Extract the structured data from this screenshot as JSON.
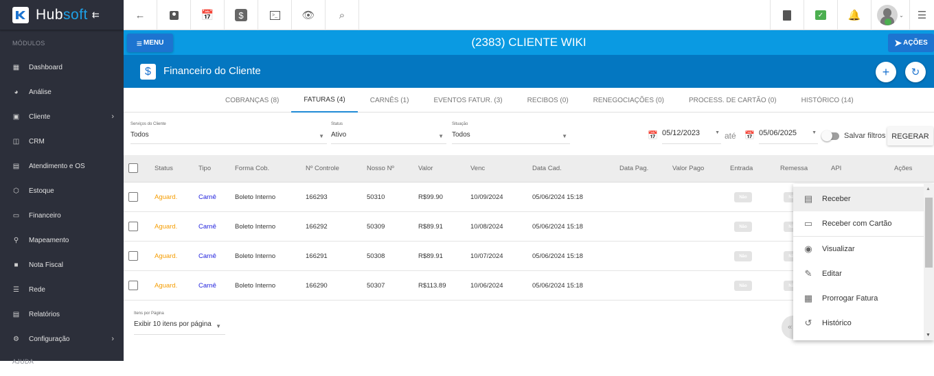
{
  "sidebar": {
    "brand_prefix": "Hub",
    "brand_suffix": "soft",
    "section_modules": "MÓDULOS",
    "section_help": "AJUDA",
    "items": [
      {
        "label": "Dashboard",
        "icon": "dashboard-icon",
        "has_chevron": false
      },
      {
        "label": "Análise",
        "icon": "pie-chart-icon",
        "has_chevron": false
      },
      {
        "label": "Cliente",
        "icon": "contact-card-icon",
        "has_chevron": true
      },
      {
        "label": "CRM",
        "icon": "kanban-board-icon",
        "has_chevron": false
      },
      {
        "label": "Atendimento e OS",
        "icon": "calendar-clock-icon",
        "has_chevron": false
      },
      {
        "label": "Estoque",
        "icon": "box-icon",
        "has_chevron": false
      },
      {
        "label": "Financeiro",
        "icon": "money-icon",
        "has_chevron": false
      },
      {
        "label": "Mapeamento",
        "icon": "map-pin-icon",
        "has_chevron": false
      },
      {
        "label": "Nota Fiscal",
        "icon": "receipt-icon",
        "has_chevron": false
      },
      {
        "label": "Rede",
        "icon": "network-icon",
        "has_chevron": false
      },
      {
        "label": "Relatórios",
        "icon": "document-icon",
        "has_chevron": false
      },
      {
        "label": "Configuração",
        "icon": "gear-icon",
        "has_chevron": true
      }
    ]
  },
  "topbar": {
    "left_icons": [
      "back-arrow-icon",
      "contact-card-icon",
      "calendar-clock-icon",
      "dollar-icon",
      "terminal-icon",
      "eye-icon",
      "search-icon"
    ],
    "right_icons": [
      "pdf-icon",
      "chat-check-icon",
      "bell-icon",
      "avatar",
      "list-icon"
    ],
    "chat_color": "#4caf50"
  },
  "header": {
    "menu_label": "MENU",
    "client_title": "(2383) CLIENTE WIKI",
    "actions_label": "AÇÕES",
    "section_title": "Financeiro do Cliente"
  },
  "tabs": [
    {
      "label": "COBRANÇAS (8)",
      "active": false
    },
    {
      "label": "FATURAS (4)",
      "active": true
    },
    {
      "label": "CARNÊS (1)",
      "active": false
    },
    {
      "label": "EVENTOS FATUR. (3)",
      "active": false
    },
    {
      "label": "RECIBOS (0)",
      "active": false
    },
    {
      "label": "RENEGOCIAÇÕES (0)",
      "active": false
    },
    {
      "label": "PROCESS. DE CARTÃO (0)",
      "active": false
    },
    {
      "label": "HISTÓRICO (14)",
      "active": false
    }
  ],
  "filters": {
    "servicos_label": "Serviços do Cliente",
    "servicos_value": "Todos",
    "status_label": "Status",
    "status_value": "Ativo",
    "situacao_label": "Situação",
    "situacao_value": "Todos",
    "date_from": "05/12/2023",
    "date_sep": "até",
    "date_to": "05/06/2025",
    "save_filters_label": "Salvar filtros",
    "save_filters_on": false,
    "regerar_label": "REGERAR"
  },
  "table": {
    "columns": [
      "Status",
      "Tipo",
      "Forma Cob.",
      "Nº Controle",
      "Nosso Nº",
      "Valor",
      "Venc",
      "Data Cad.",
      "Data Pag.",
      "Valor Pago",
      "Entrada",
      "Remessa",
      "API",
      "Ações"
    ],
    "status_color": "#f59c00",
    "tipo_color": "#2222dd",
    "rows": [
      {
        "status": "Aguard.",
        "tipo": "Carnê",
        "forma": "Boleto Interno",
        "controle": "166293",
        "nosso": "50310",
        "valor": "R$99.90",
        "venc": "10/09/2024",
        "data_cad": "05/06/2024 15:18",
        "data_pag": "",
        "valor_pago": "",
        "entrada": "Não",
        "remessa": "Não"
      },
      {
        "status": "Aguard.",
        "tipo": "Carnê",
        "forma": "Boleto Interno",
        "controle": "166292",
        "nosso": "50309",
        "valor": "R$89.91",
        "venc": "10/08/2024",
        "data_cad": "05/06/2024 15:18",
        "data_pag": "",
        "valor_pago": "",
        "entrada": "Não",
        "remessa": "Não"
      },
      {
        "status": "Aguard.",
        "tipo": "Carnê",
        "forma": "Boleto Interno",
        "controle": "166291",
        "nosso": "50308",
        "valor": "R$89.91",
        "venc": "10/07/2024",
        "data_cad": "05/06/2024 15:18",
        "data_pag": "",
        "valor_pago": "",
        "entrada": "Não",
        "remessa": "Não"
      },
      {
        "status": "Aguard.",
        "tipo": "Carnê",
        "forma": "Boleto Interno",
        "controle": "166290",
        "nosso": "50307",
        "valor": "R$113.89",
        "venc": "10/06/2024",
        "data_cad": "05/06/2024 15:18",
        "data_pag": "",
        "valor_pago": "",
        "entrada": "Não",
        "remessa": "Não"
      }
    ]
  },
  "pagination": {
    "label": "Itens por Página",
    "value": "Exibir 10 itens por página",
    "prev_icon": "«"
  },
  "actions_menu": {
    "items": [
      {
        "label": "Receber",
        "icon": "list-document-icon",
        "highlighted": true
      },
      {
        "label": "Receber com Cartão",
        "icon": "credit-card-icon",
        "highlighted": false
      },
      {
        "label": "Visualizar",
        "icon": "eye-icon",
        "highlighted": false
      },
      {
        "label": "Editar",
        "icon": "pencil-icon",
        "highlighted": false
      },
      {
        "label": "Prorrogar Fatura",
        "icon": "calendar-clock-icon",
        "highlighted": false
      },
      {
        "label": "Histórico",
        "icon": "history-icon",
        "highlighted": false
      }
    ]
  }
}
